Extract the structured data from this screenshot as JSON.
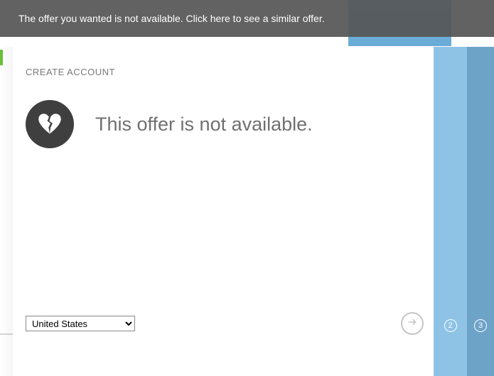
{
  "banner": {
    "text": "The offer you wanted is not available. Click here to see a similar offer."
  },
  "panel": {
    "title": "CREATE ACCOUNT",
    "message": "This offer is not available."
  },
  "footer": {
    "country_selected": "United States"
  },
  "steps": {
    "s2": "2",
    "s3": "3"
  }
}
